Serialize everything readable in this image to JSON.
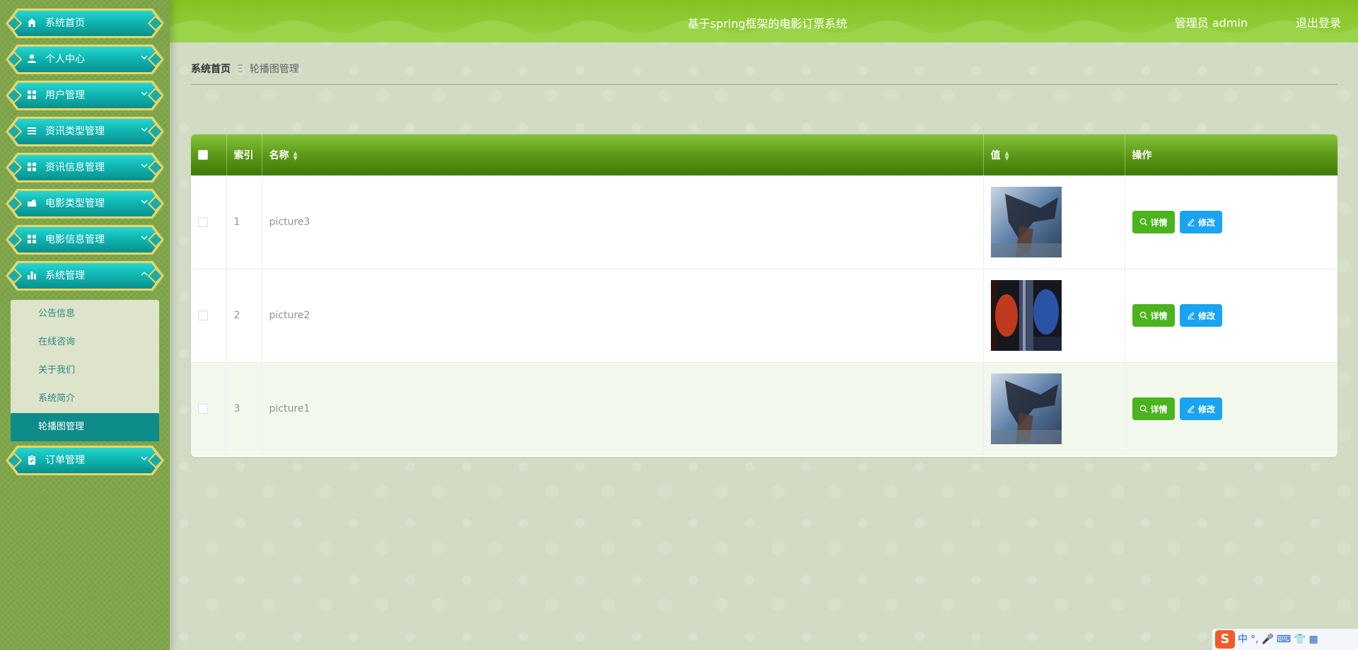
{
  "app": {
    "title": "基于spring框架的电影订票系统",
    "user": "管理员 admin",
    "logout": "退出登录"
  },
  "sidebar": {
    "items": [
      {
        "label": "系统首页",
        "icon": "home-icon",
        "glyph": "⌂",
        "chevron": ""
      },
      {
        "label": "个人中心",
        "icon": "user-icon",
        "glyph": "●",
        "chevron": "⌵"
      },
      {
        "label": "用户管理",
        "icon": "grid-icon",
        "glyph": "▦",
        "chevron": "⌵"
      },
      {
        "label": "资讯类型管理",
        "icon": "list-icon",
        "glyph": "☰",
        "chevron": "⌵"
      },
      {
        "label": "资讯信息管理",
        "icon": "grid-icon",
        "glyph": "▦",
        "chevron": "⌵"
      },
      {
        "label": "电影类型管理",
        "icon": "folder-icon",
        "glyph": "▰",
        "chevron": "⌵"
      },
      {
        "label": "电影信息管理",
        "icon": "grid-icon",
        "glyph": "▦",
        "chevron": "⌵"
      },
      {
        "label": "系统管理",
        "icon": "bar-chart-icon",
        "glyph": "▮",
        "chevron": "^"
      },
      {
        "label": "订单管理",
        "icon": "clipboard-icon",
        "glyph": "▣",
        "chevron": "⌵"
      }
    ],
    "submenu": [
      {
        "label": "公告信息"
      },
      {
        "label": "在线咨询"
      },
      {
        "label": "关于我们"
      },
      {
        "label": "系统简介"
      },
      {
        "label": "轮播图管理"
      }
    ]
  },
  "breadcrumb": {
    "home": "系统首页",
    "separator": "Ξ",
    "current": "轮播图管理"
  },
  "table": {
    "headers": {
      "index": "索引",
      "name": "名称",
      "value": "值",
      "actions": "操作"
    },
    "rows": [
      {
        "index": "1",
        "name": "picture3",
        "image": "battle-scene"
      },
      {
        "index": "2",
        "name": "picture2",
        "image": "red-blue-split"
      },
      {
        "index": "3",
        "name": "picture1",
        "image": "battle-scene"
      }
    ],
    "detail_label": "详情",
    "edit_label": "修改"
  },
  "ime": {
    "logo": "S",
    "lang": "中",
    "items": [
      "°,",
      "🎤",
      "⌨",
      "👕",
      "▦"
    ]
  },
  "colors": {
    "header": "#8fcc35",
    "sidebar": "#7fa648",
    "menu_teal": "#0fb6b2",
    "menu_border": "#e8d66a",
    "table_header": "#5d9a18",
    "detail_button": "#4bb31e",
    "edit_button": "#1aa3f0",
    "submenu_active": "#0d8c89"
  }
}
